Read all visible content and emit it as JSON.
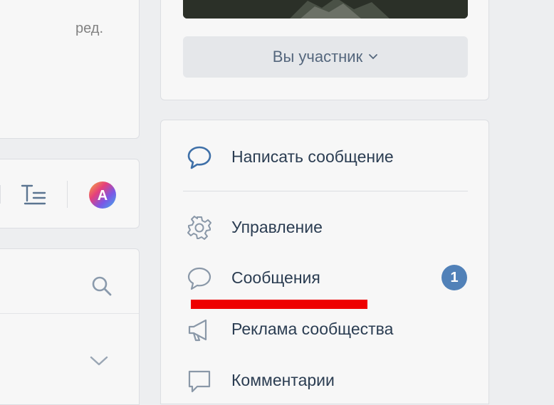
{
  "left_panel": {
    "edit_link": "ред."
  },
  "community_header": {
    "member_button_label": "Вы участник"
  },
  "community_menu": {
    "write_message": "Написать сообщение",
    "items": [
      {
        "label": "Управление",
        "icon": "gear-icon"
      },
      {
        "label": "Сообщения",
        "icon": "speech-bubble-icon",
        "badge": "1"
      },
      {
        "label": "Реклама сообщества",
        "icon": "megaphone-icon"
      },
      {
        "label": "Комментарии",
        "icon": "comment-icon"
      }
    ]
  },
  "colors": {
    "accent": "#5181b8",
    "highlight": "#ee0000",
    "text": "#2b3d52"
  }
}
